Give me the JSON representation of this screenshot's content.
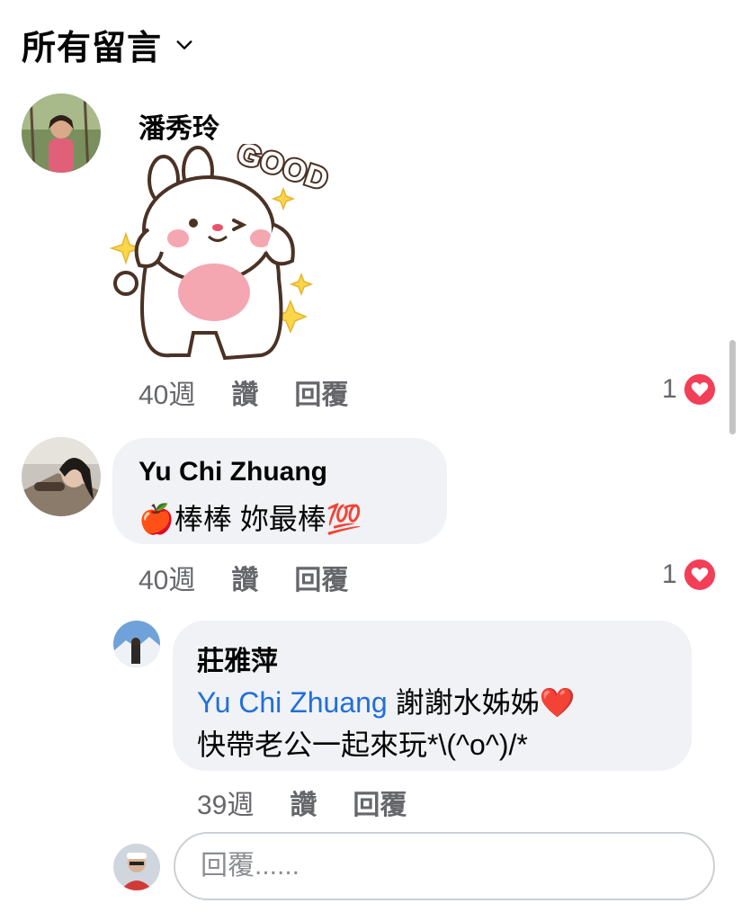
{
  "header": {
    "title": "所有留言"
  },
  "comments": [
    {
      "author": "潘秀玲",
      "sticker_text": "GOOD",
      "time": "40週",
      "like_label": "讚",
      "reply_label": "回覆",
      "reaction_count": "1"
    },
    {
      "author": "Yu Chi Zhuang",
      "text": "🍎棒棒 妳最棒💯",
      "time": "40週",
      "like_label": "讚",
      "reply_label": "回覆",
      "reaction_count": "1"
    }
  ],
  "reply": {
    "author": "莊雅萍",
    "mention": "Yu Chi Zhuang",
    "text_line1": " 謝謝水姊姊❤️",
    "text_line2": "快帶老公一起來玩*\\(^o^)/*",
    "time": "39週",
    "like_label": "讚",
    "reply_label": "回覆"
  },
  "reply_input": {
    "placeholder": "回覆......"
  },
  "colors": {
    "link": "#216fdb",
    "bubble": "#f0f2f5",
    "meta": "#65676b",
    "heart": "#f33e58"
  }
}
